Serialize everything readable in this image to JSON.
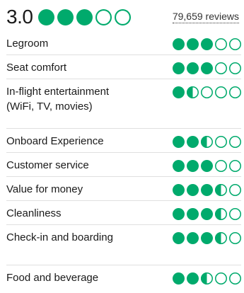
{
  "overall": {
    "score": "3.0",
    "rating": 3,
    "reviews": "79,659 reviews"
  },
  "colors": {
    "accent": "#00aa6c",
    "divider": "#e0e0e0"
  },
  "categories": [
    {
      "label": "Legroom",
      "rating": 3
    },
    {
      "label": "Seat comfort",
      "rating": 3
    },
    {
      "label": "In-flight entertainment (WiFi, TV, movies)",
      "rating": 1.5
    },
    {
      "label": "Onboard Experience",
      "rating": 2.5
    },
    {
      "label": "Customer service",
      "rating": 3
    },
    {
      "label": "Value for money",
      "rating": 3.5
    },
    {
      "label": "Cleanliness",
      "rating": 3.5
    },
    {
      "label": "Check-in and boarding",
      "rating": 3.5
    },
    {
      "label": "Food and beverage",
      "rating": 2.5
    }
  ]
}
